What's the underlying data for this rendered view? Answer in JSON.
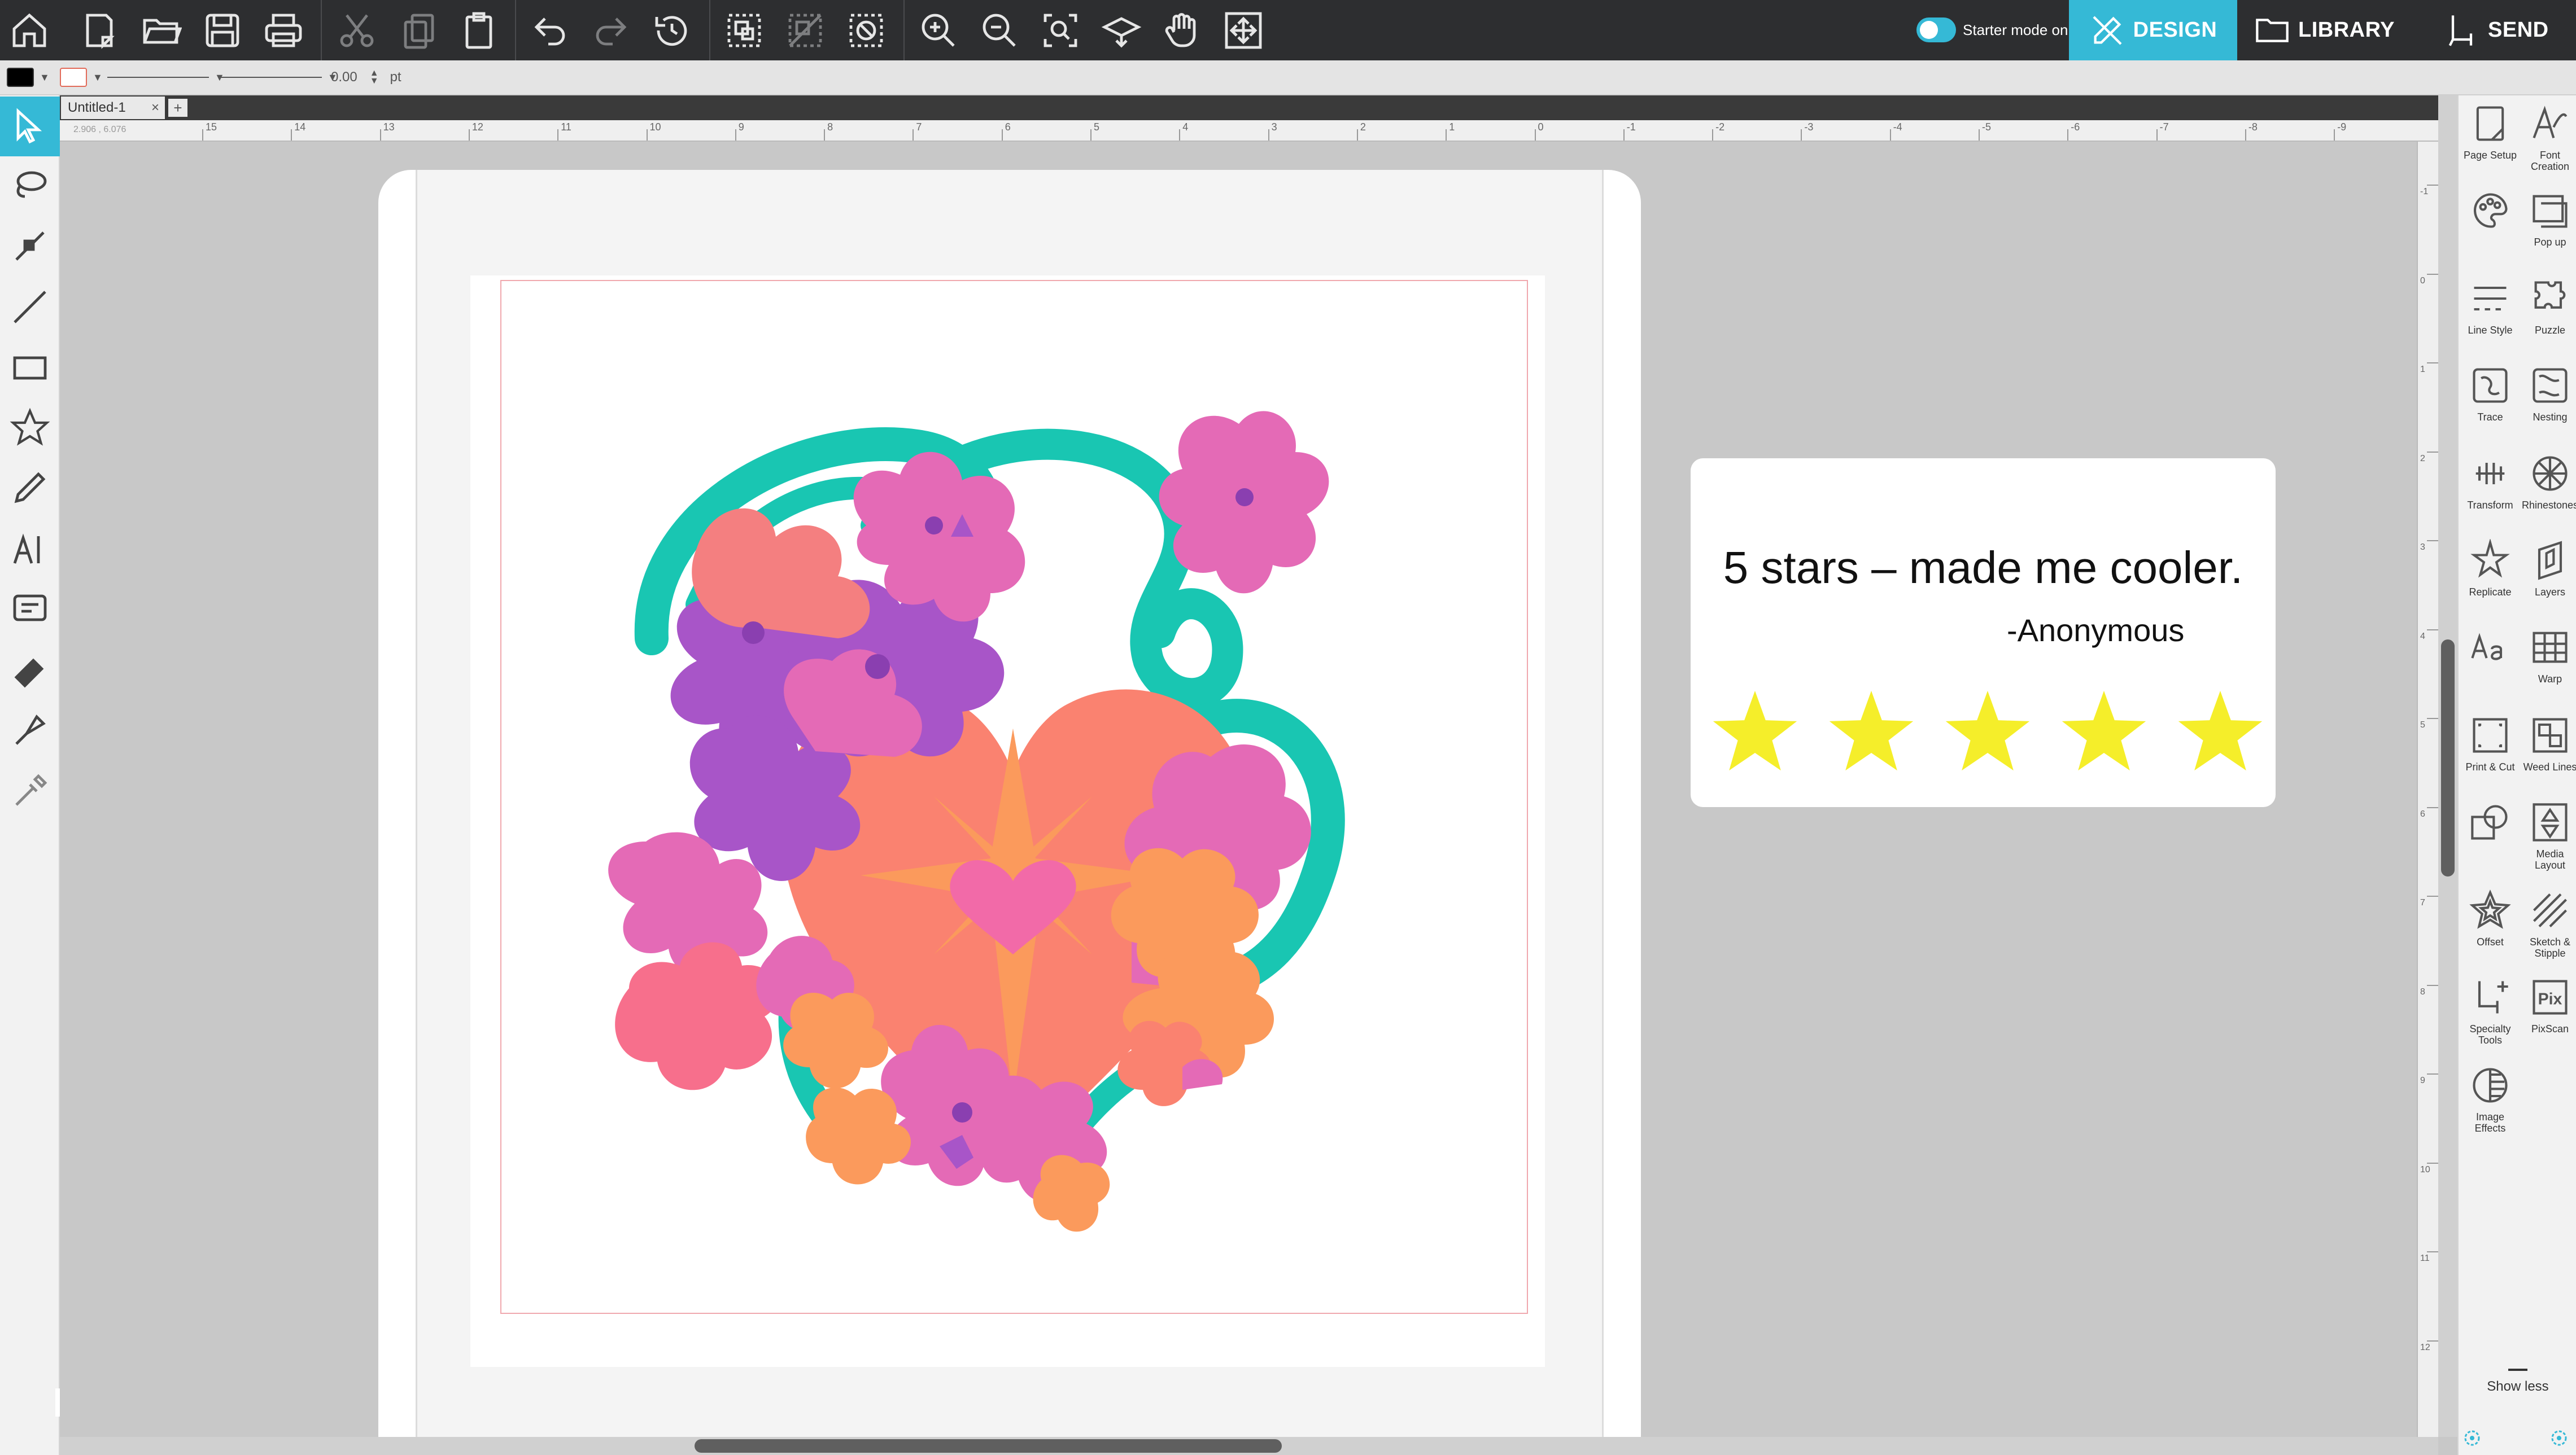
{
  "topbar": {
    "starter_mode_label": "Starter mode on",
    "tabs": [
      {
        "label": "DESIGN",
        "icon": "pen-icon",
        "active": true
      },
      {
        "label": "LIBRARY",
        "icon": "folder-icon",
        "active": false
      },
      {
        "label": "SEND",
        "icon": "cutter-icon",
        "active": false
      }
    ],
    "accent_color": "#35b9d6"
  },
  "propbar": {
    "line_width_value": "0.00",
    "line_width_unit": "pt"
  },
  "document": {
    "tab_title": "Untitled-1",
    "close_glyph": "×",
    "add_tab_glyph": "+",
    "cursor_coords": "2.906 , 6.076"
  },
  "rulers": {
    "horizontal_labels": [
      "15",
      "14",
      "13",
      "12",
      "11",
      "10",
      "9",
      "8",
      "7",
      "6",
      "5",
      "4",
      "3",
      "2",
      "1",
      "0",
      "-1",
      "-2",
      "-3",
      "-4",
      "-5",
      "-6",
      "-7",
      "-8",
      "-9"
    ],
    "vertical_labels": [
      "-1",
      "0",
      "1",
      "2",
      "3",
      "4",
      "5",
      "6",
      "7",
      "8",
      "9",
      "10",
      "11",
      "12"
    ]
  },
  "quote_card": {
    "text": "5 stars – made me cooler.",
    "author": "-Anonymous",
    "rating": 5,
    "star_color": "#f5ee2a"
  },
  "right_panel": {
    "items": [
      {
        "label": "Page Setup",
        "icon": "page-setup-icon"
      },
      {
        "label": "Font Creation",
        "icon": "font-creation-icon"
      },
      {
        "label": "",
        "icon": "palette-icon"
      },
      {
        "label": "Pop up",
        "icon": "pop-up-icon"
      },
      {
        "label": "Line Style",
        "icon": "line-style-icon"
      },
      {
        "label": "Puzzle",
        "icon": "puzzle-icon"
      },
      {
        "label": "Trace",
        "icon": "trace-icon"
      },
      {
        "label": "Nesting",
        "icon": "nesting-icon"
      },
      {
        "label": "Transform",
        "icon": "transform-icon"
      },
      {
        "label": "Rhinestones",
        "icon": "rhinestone-icon"
      },
      {
        "label": "Replicate",
        "icon": "replicate-icon"
      },
      {
        "label": "Layers",
        "icon": "layers-icon"
      },
      {
        "label": "",
        "icon": "text-style-icon"
      },
      {
        "label": "Warp",
        "icon": "warp-icon"
      },
      {
        "label": "Print & Cut",
        "icon": "print-cut-icon"
      },
      {
        "label": "Weed Lines",
        "icon": "weed-lines-icon"
      },
      {
        "label": "",
        "icon": "modify-icon"
      },
      {
        "label": "Media Layout",
        "icon": "media-layout-icon"
      },
      {
        "label": "Offset",
        "icon": "offset-icon"
      },
      {
        "label": "Sketch & Stipple",
        "icon": "sketch-stipple-icon"
      },
      {
        "label": "Specialty Tools",
        "icon": "specialty-tools-icon"
      },
      {
        "label": "PixScan",
        "icon": "pixscan-icon"
      },
      {
        "label": "Image Effects",
        "icon": "image-effects-icon"
      }
    ],
    "show_less": "Show less"
  }
}
